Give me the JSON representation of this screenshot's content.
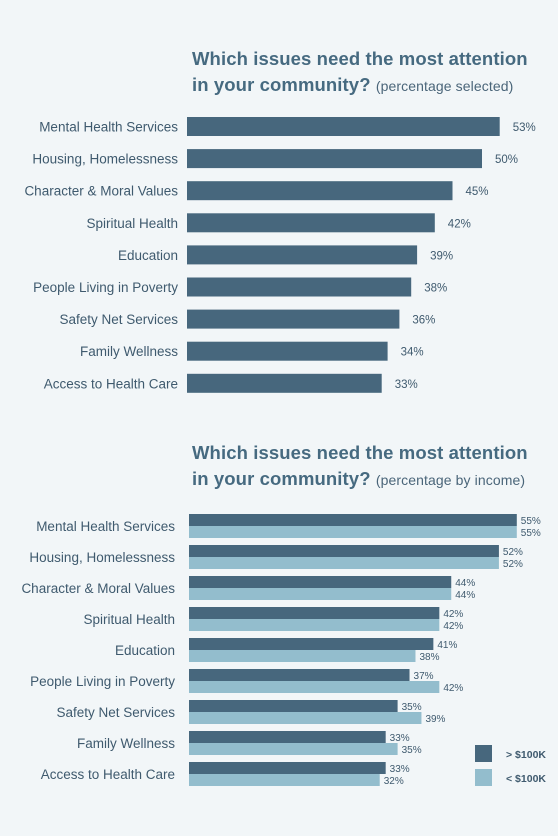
{
  "colors": {
    "dark": "#47677d",
    "light": "#93bdcd",
    "background": "#f2f6f8",
    "text": "#3f5a6e"
  },
  "chart_data": [
    {
      "type": "bar",
      "orientation": "horizontal",
      "title": "Which issues need the most attention in your community?",
      "subtitle": "(percentage selected)",
      "categories": [
        "Mental Health Services",
        "Housing, Homelessness",
        "Character & Moral Values",
        "Spiritual Health",
        "Education",
        "People Living in Poverty",
        "Safety Net Services",
        "Family Wellness",
        "Access to Health Care"
      ],
      "values": [
        53,
        50,
        45,
        42,
        39,
        38,
        36,
        34,
        33
      ],
      "value_labels": [
        "53%",
        "50%",
        "45%",
        "42%",
        "39%",
        "38%",
        "36%",
        "34%",
        "33%"
      ],
      "xlabel": "",
      "ylabel": "",
      "xlim": [
        0,
        55
      ],
      "grid": false
    },
    {
      "type": "bar",
      "orientation": "horizontal",
      "title": "Which issues need the most attention in your community?",
      "subtitle": "(percentage by income)",
      "categories": [
        "Mental Health Services",
        "Housing, Homelessness",
        "Character & Moral Values",
        "Spiritual Health",
        "Education",
        "People Living in Poverty",
        "Safety Net Services",
        "Family Wellness",
        "Access to Health Care"
      ],
      "series": [
        {
          "name": "> $100K",
          "values": [
            55,
            52,
            44,
            42,
            41,
            37,
            35,
            33,
            33
          ]
        },
        {
          "name": "< $100K",
          "values": [
            55,
            52,
            44,
            42,
            38,
            42,
            39,
            35,
            32
          ]
        }
      ],
      "legend": {
        "position": "bottom-right",
        "entries": [
          "> $100K",
          "< $100K"
        ]
      },
      "xlabel": "",
      "ylabel": "",
      "xlim": [
        0,
        55
      ],
      "grid": false
    }
  ]
}
